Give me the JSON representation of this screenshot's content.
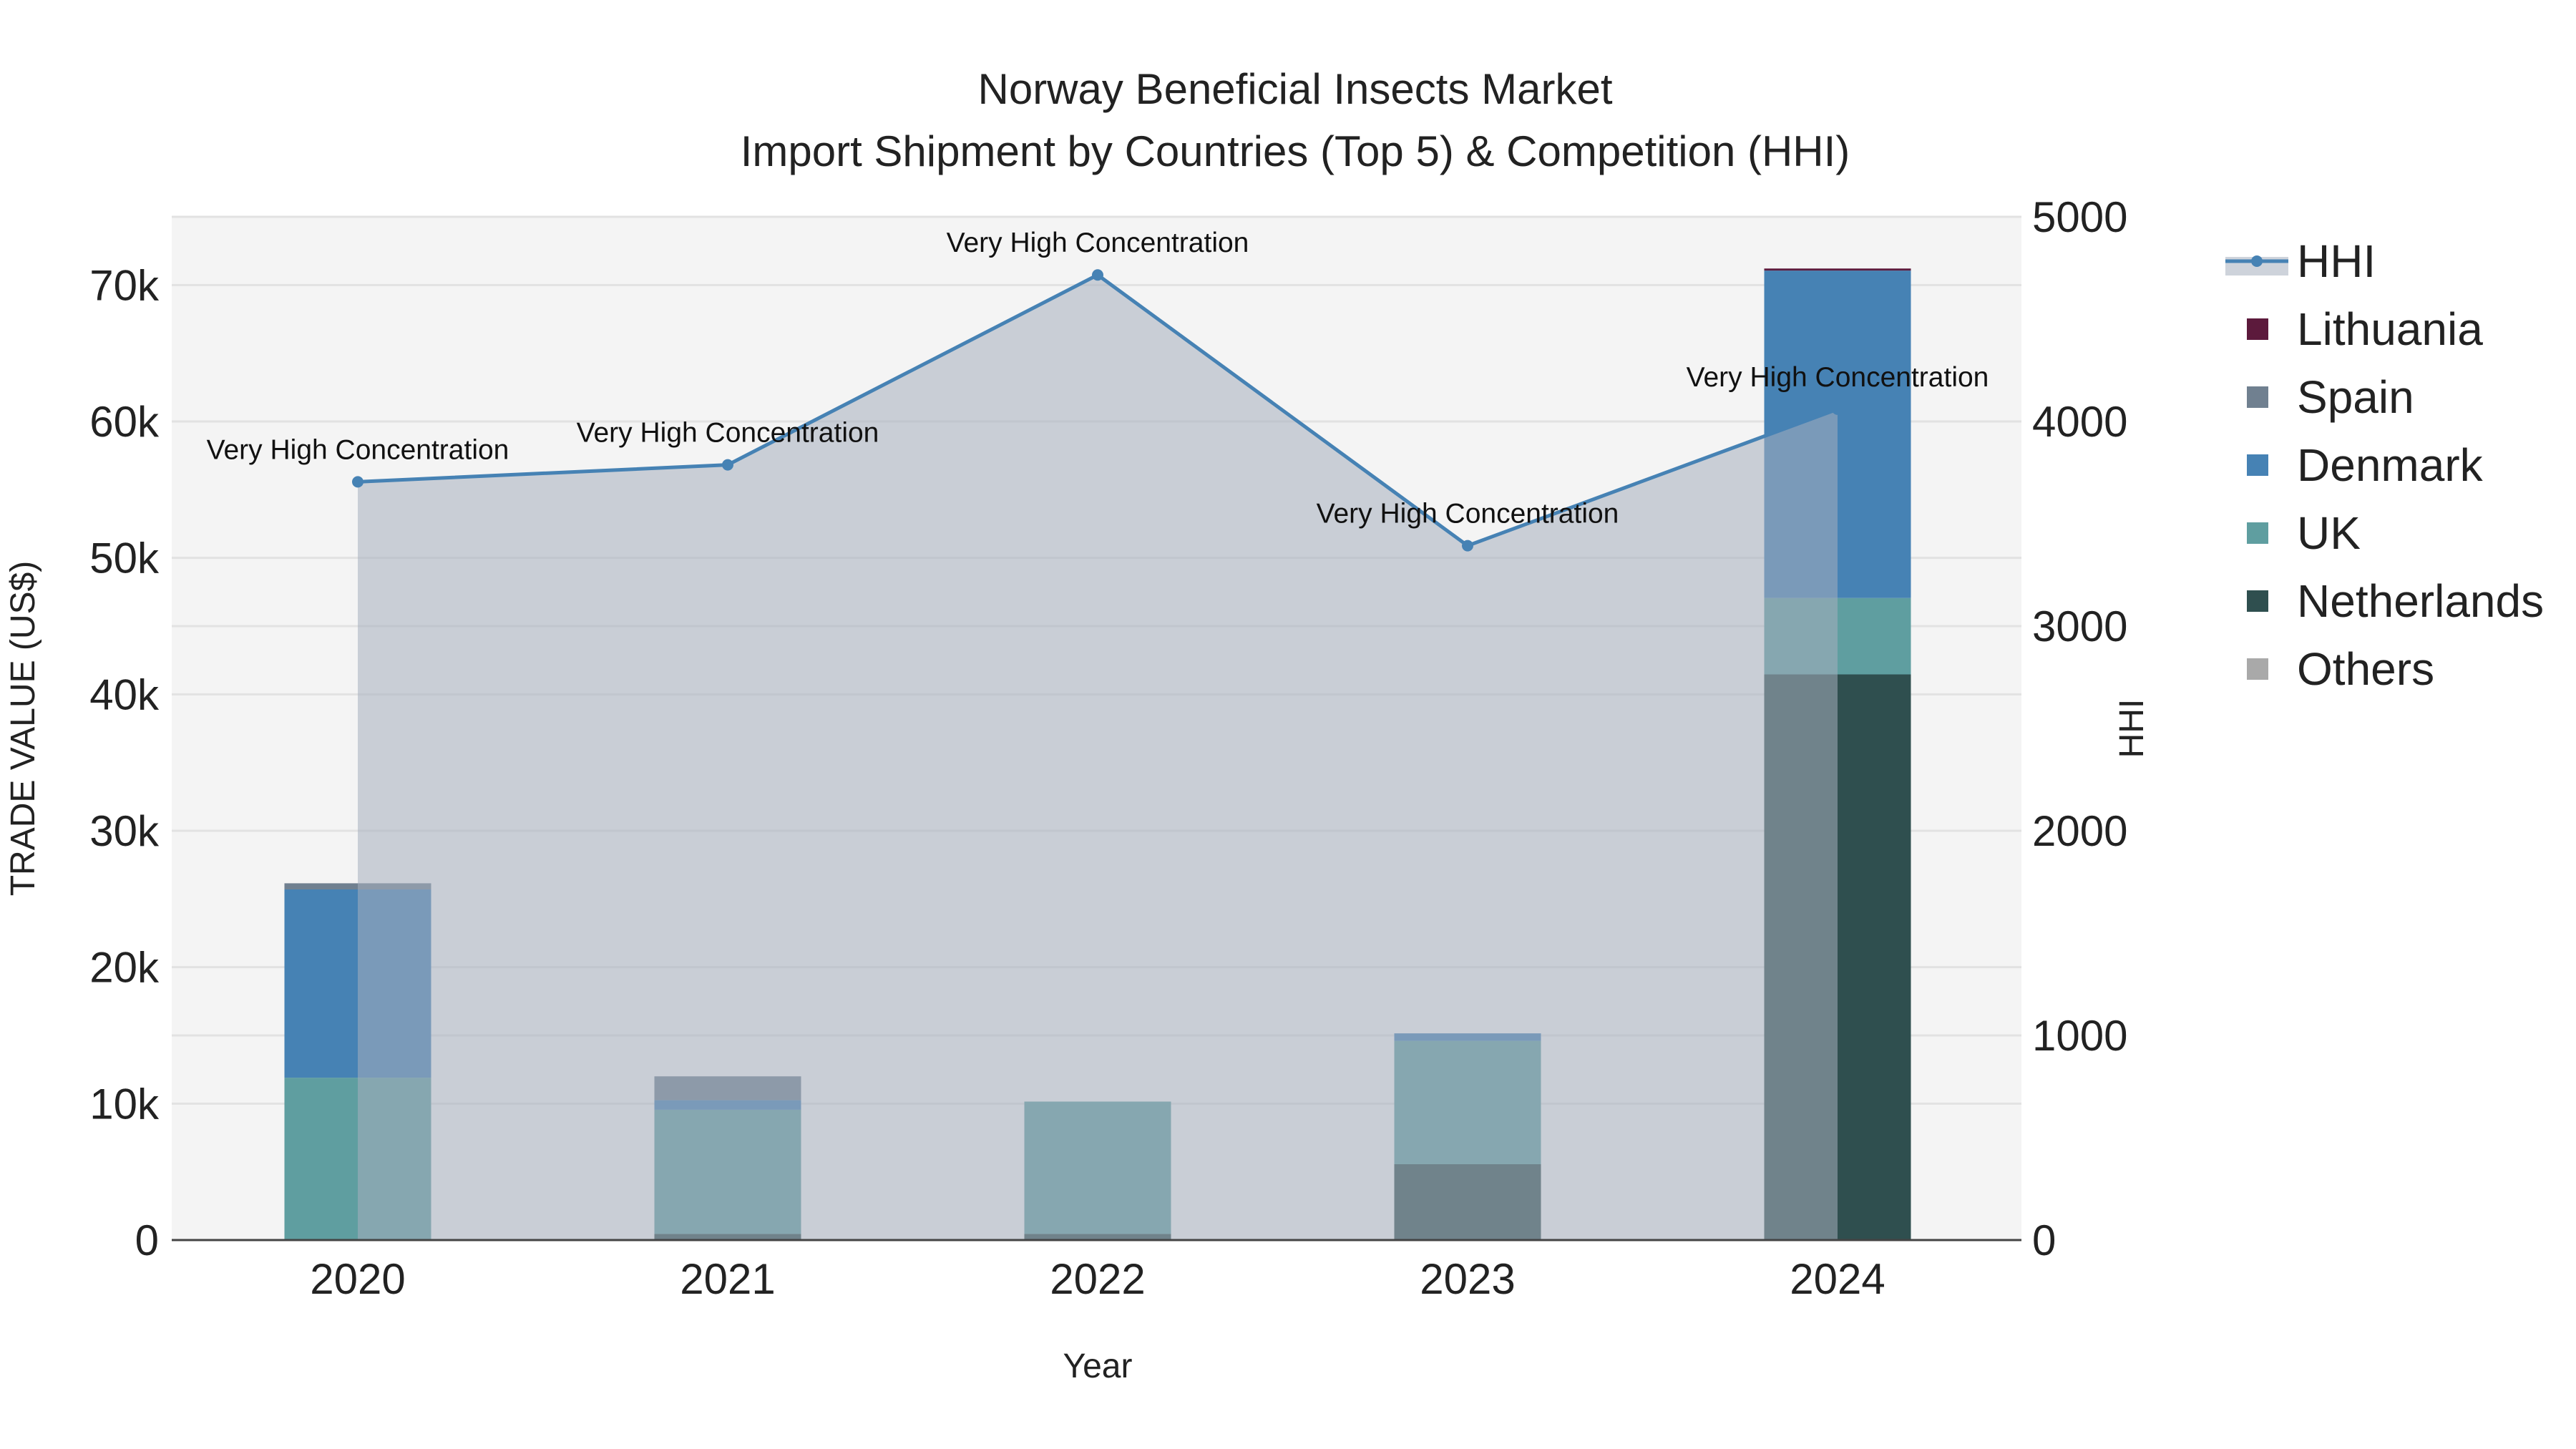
{
  "chart_data": {
    "type": "bar",
    "title": "Norway Beneficial Insects Market",
    "subtitle": "Import Shipment by Countries (Top 5) & Competition (HHI)",
    "xlabel": "Year",
    "ylabel": "TRADE VALUE (US$)",
    "y2label": "HHI",
    "categories": [
      "2020",
      "2021",
      "2022",
      "2023",
      "2024"
    ],
    "ylim": [
      0,
      75000
    ],
    "y_ticks": [
      0,
      10000,
      20000,
      30000,
      40000,
      50000,
      60000,
      70000
    ],
    "y_tick_labels": [
      "0",
      "10k",
      "20k",
      "30k",
      "40k",
      "50k",
      "60k",
      "70k"
    ],
    "y2lim": [
      0,
      5000
    ],
    "y2_ticks": [
      0,
      1000,
      2000,
      3000,
      4000,
      5000
    ],
    "y2_tick_labels": [
      "0",
      "1000",
      "2000",
      "3000",
      "4000",
      "5000"
    ],
    "grid": true,
    "barmode": "stack",
    "series": [
      {
        "name": "Netherlands",
        "color": "#2F4F4F",
        "values": [
          0,
          450,
          450,
          5560,
          41460
        ]
      },
      {
        "name": "UK",
        "color": "#5F9EA0",
        "values": [
          11900,
          9100,
          9700,
          9040,
          5600
        ]
      },
      {
        "name": "Denmark",
        "color": "#4682B4",
        "values": [
          13800,
          700,
          0,
          550,
          24000
        ]
      },
      {
        "name": "Spain",
        "color": "#708090",
        "values": [
          450,
          1750,
          0,
          0,
          0
        ]
      },
      {
        "name": "Lithuania",
        "color": "#5C1A3C",
        "values": [
          0,
          0,
          0,
          0,
          150
        ]
      },
      {
        "name": "Others",
        "color": "#A9A9A9",
        "values": [
          0,
          0,
          0,
          0,
          0
        ]
      }
    ],
    "hhi": {
      "name": "HHI",
      "color": "#4682B4",
      "values": [
        3705,
        3788,
        4716,
        3393,
        4060
      ],
      "annotations": [
        "Very High Concentration",
        "Very High Concentration",
        "Very High Concentration",
        "Very High Concentration",
        "Very High Concentration"
      ]
    },
    "legend": {
      "placement": "right",
      "entries": [
        "HHI",
        "Lithuania",
        "Spain",
        "Denmark",
        "UK",
        "Netherlands",
        "Others"
      ]
    }
  }
}
